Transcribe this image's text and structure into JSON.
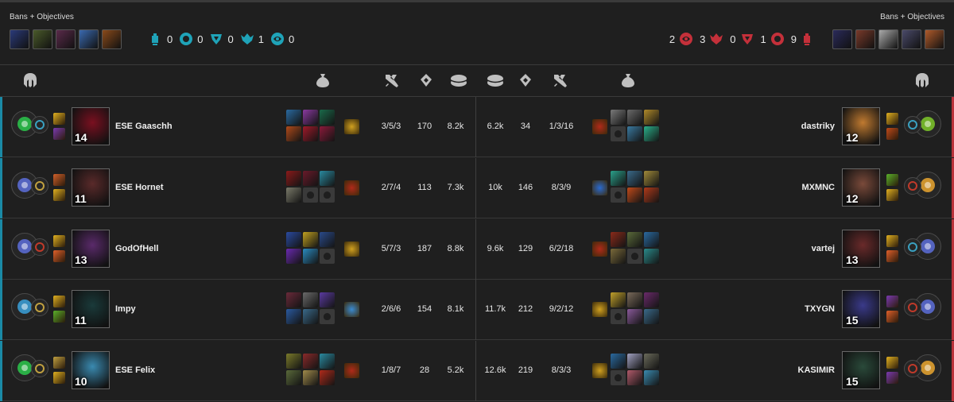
{
  "header": {
    "left_title": "Bans + Objectives",
    "right_title": "Bans + Objectives",
    "left_bans": [
      "#2a3a7a",
      "#4a5a2a",
      "#5a2a4a",
      "#3a6ab0",
      "#8a4a1a"
    ],
    "right_bans": [
      "#2a2a5a",
      "#7a3a2a",
      "#aaaaaa",
      "#4a4a6a",
      "#b05a2a"
    ],
    "left_objectives": [
      {
        "icon": "tower-icon",
        "count": "0"
      },
      {
        "icon": "inhibitor-icon",
        "count": "0"
      },
      {
        "icon": "baron-icon",
        "count": "0"
      },
      {
        "icon": "dragon-icon",
        "count": "1"
      },
      {
        "icon": "rift-herald-icon",
        "count": "0"
      }
    ],
    "right_objectives": [
      {
        "count": "2",
        "icon": "rift-herald-icon"
      },
      {
        "count": "3",
        "icon": "dragon-icon"
      },
      {
        "count": "0",
        "icon": "baron-icon"
      },
      {
        "count": "1",
        "icon": "inhibitor-icon"
      },
      {
        "count": "9",
        "icon": "tower-icon"
      }
    ],
    "blue_color": "#1fa3b8",
    "red_color": "#c4303a"
  },
  "columns": {
    "left": [
      "champion-helmet-icon",
      "items-icon",
      "kda-icon",
      "cs-icon",
      "gold-icon"
    ],
    "right": [
      "gold-icon",
      "cs-icon",
      "kda-icon",
      "items-icon",
      "champion-helmet-icon"
    ]
  },
  "rows": [
    {
      "blue": {
        "name": "ESE Gaaschh",
        "level": "14",
        "kda": "3/5/3",
        "cs": "170",
        "gold": "8.2k",
        "champ_color": "#7a1020",
        "rune": "#2bbf4a",
        "secondary": "#3aa0c0",
        "spells": [
          "#e0b020",
          "#7a3ab0"
        ],
        "items": [
          "#2a6aa0",
          "#8a3aa0",
          "#1a6a4a",
          "#b04a1a",
          "#a01a2a",
          "#8a1a3a"
        ],
        "trinket": "#d0a020"
      },
      "red": {
        "name": "dastriky",
        "level": "12",
        "kda": "1/3/16",
        "cs": "34",
        "gold": "6.2k",
        "champ_color": "#c07a30",
        "rune": "#7ac02a",
        "secondary": "#3aa0c0",
        "spells": [
          "#e0b020",
          "#c04a1a"
        ],
        "items": [
          "#7a7a7a",
          "#6a6a6a",
          "#b08a2a",
          "empty",
          "#3a7aa0",
          "#2ab08a"
        ],
        "trinket": "#b02a1a"
      }
    },
    {
      "blue": {
        "name": "ESE Hornet",
        "level": "11",
        "kda": "2/7/4",
        "cs": "113",
        "gold": "7.3k",
        "champ_color": "#5a2a2a",
        "rune": "#5a6ad0",
        "secondary": "#c0a040",
        "spells": [
          "#d0602a",
          "#e0b020"
        ],
        "items": [
          "#8a1a1a",
          "#6a1a2a",
          "#2a8aa0",
          "#7a7a6a",
          "empty",
          "empty"
        ],
        "trinket": "#b02a1a"
      },
      "red": {
        "name": "MXMNC",
        "level": "12",
        "kda": "8/3/9",
        "cs": "146",
        "gold": "10k",
        "champ_color": "#7a4a3a",
        "rune": "#e0a030",
        "secondary": "#c03a2a",
        "spells": [
          "#5ab02a",
          "#e0b020"
        ],
        "items": [
          "#2aa08a",
          "#3a6a8a",
          "#a08a3a",
          "empty",
          "#c04a1a",
          "#b03a1a"
        ],
        "trinket": "#2a6ad0"
      }
    },
    {
      "blue": {
        "name": "GodOfHell",
        "level": "13",
        "kda": "5/7/3",
        "cs": "187",
        "gold": "8.8k",
        "champ_color": "#5a2a6a",
        "rune": "#5a6ad0",
        "secondary": "#c03a2a",
        "spells": [
          "#e0b020",
          "#e0602a"
        ],
        "items": [
          "#2a4aa0",
          "#c0a020",
          "#2a4a8a",
          "#6a2ab0",
          "#2a8ac0",
          "empty"
        ],
        "trinket": "#d0a020"
      },
      "red": {
        "name": "vartej",
        "level": "13",
        "kda": "6/2/18",
        "cs": "129",
        "gold": "9.6k",
        "champ_color": "#6a2a2a",
        "rune": "#5a6ad0",
        "secondary": "#3aa0c0",
        "spells": [
          "#e0b020",
          "#e0602a"
        ],
        "items": [
          "#8a2a1a",
          "#5a6a3a",
          "#2a6aa0",
          "#7a6a3a",
          "empty",
          "#2a8a8a"
        ],
        "trinket": "#b02a1a"
      }
    },
    {
      "blue": {
        "name": "Impy",
        "level": "11",
        "kda": "2/6/6",
        "cs": "154",
        "gold": "8.1k",
        "champ_color": "#1a3a3a",
        "rune": "#3a9ad0",
        "secondary": "#c0a040",
        "spells": [
          "#e0b020",
          "#5ab02a"
        ],
        "items": [
          "#6a2a3a",
          "#6a6a6a",
          "#5a3aa0",
          "#2a5aa0",
          "#3a6a8a",
          "empty"
        ],
        "trinket": "#3a8ad0"
      },
      "red": {
        "name": "TXYGN",
        "level": "15",
        "kda": "9/2/12",
        "cs": "212",
        "gold": "11.7k",
        "champ_color": "#3a3a8a",
        "rune": "#5a6ad0",
        "secondary": "#c03a2a",
        "spells": [
          "#7a3ab0",
          "#e0602a"
        ],
        "items": [
          "#c0a02a",
          "#7a6a5a",
          "#6a2a6a",
          "empty",
          "#8a5a9a",
          "#3a6a8a"
        ],
        "trinket": "#d0a020"
      }
    },
    {
      "blue": {
        "name": "ESE Felix",
        "level": "10",
        "kda": "1/8/7",
        "cs": "28",
        "gold": "5.2k",
        "champ_color": "#3a8ab0",
        "rune": "#2bbf4a",
        "secondary": "#c0a040",
        "spells": [
          "#c0a040",
          "#e0b020"
        ],
        "items": [
          "#7a7a2a",
          "#8a2a2a",
          "#2a8aa0",
          "#5a6a3a",
          "#a08a4a",
          "#b02a1a"
        ],
        "trinket": "#b02a1a"
      },
      "red": {
        "name": "KASIMIR",
        "level": "15",
        "kda": "8/3/3",
        "cs": "219",
        "gold": "12.6k",
        "champ_color": "#2a4a3a",
        "rune": "#e0a030",
        "secondary": "#c03a2a",
        "spells": [
          "#e0b020",
          "#7a3ab0"
        ],
        "items": [
          "#2a6aa0",
          "#a0a0c0",
          "#6a6a5a",
          "empty",
          "#b05a6a",
          "#3a8ab0"
        ],
        "trinket": "#d0a020"
      }
    }
  ]
}
